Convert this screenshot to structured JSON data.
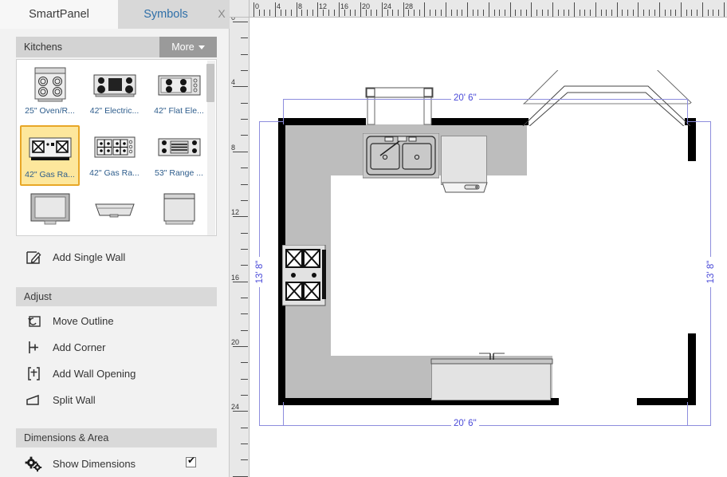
{
  "tabs": {
    "active_label": "SmartPanel",
    "inactive_label": "Symbols",
    "close_label": "X"
  },
  "palette": {
    "title": "Kitchens",
    "more_label": "More",
    "more_icon": "caret-down-icon",
    "selected_index": 3,
    "items": [
      {
        "caption": "25\" Oven/R...",
        "icon": "oven-range-top-icon"
      },
      {
        "caption": "42\" Electric...",
        "icon": "electric-cooktop-icon"
      },
      {
        "caption": "42\" Flat Ele...",
        "icon": "flat-electric-cooktop-icon"
      },
      {
        "caption": "42\" Gas Ra...",
        "icon": "gas-range-icon"
      },
      {
        "caption": "42\" Gas Ra...",
        "icon": "gas-range-alt-icon"
      },
      {
        "caption": "53\" Range ...",
        "icon": "range-hood-icon"
      },
      {
        "caption": "",
        "icon": "dishwasher-icon"
      },
      {
        "caption": "",
        "icon": "sink-basin-icon"
      },
      {
        "caption": "",
        "icon": "washer-icon"
      }
    ]
  },
  "tools": {
    "add_single_wall": {
      "label": "Add Single Wall",
      "icon": "pencil-square-icon"
    }
  },
  "sections": {
    "adjust": {
      "title": "Adjust",
      "items": [
        {
          "label": "Move Outline",
          "icon": "move-outline-icon"
        },
        {
          "label": "Add Corner",
          "icon": "add-corner-icon"
        },
        {
          "label": "Add Wall Opening",
          "icon": "add-wall-opening-icon"
        },
        {
          "label": "Split Wall",
          "icon": "split-wall-icon"
        }
      ]
    },
    "dimensions": {
      "title": "Dimensions & Area",
      "items": [
        {
          "label": "Show Dimensions",
          "icon": "gears-icon",
          "checked": true
        }
      ]
    }
  },
  "rulers": {
    "unit": "ft",
    "horizontal_labels": [
      "0",
      "4",
      "8",
      "12",
      "16",
      "20",
      "24",
      "28"
    ],
    "vertical_labels": [
      "0",
      "4",
      "8",
      "12",
      "16",
      "20",
      "24"
    ]
  },
  "plan": {
    "dim_top": "20' 6\"",
    "dim_bottom": "20' 6\"",
    "dim_left": "13' 8\"",
    "dim_right": "13' 8\"",
    "dim_color": "#4a4ad8",
    "wall_color": "#000000",
    "floor_color": "#bdbdbd",
    "counter_color": "#e3e3e3",
    "objects": [
      {
        "name": "double-basin-sink",
        "label": ""
      },
      {
        "name": "gas-range",
        "label": ""
      },
      {
        "name": "dishwasher",
        "label": ""
      },
      {
        "name": "island-counter",
        "label": ""
      },
      {
        "name": "window-opening",
        "label": ""
      },
      {
        "name": "angled-wall-opening",
        "label": ""
      }
    ]
  }
}
